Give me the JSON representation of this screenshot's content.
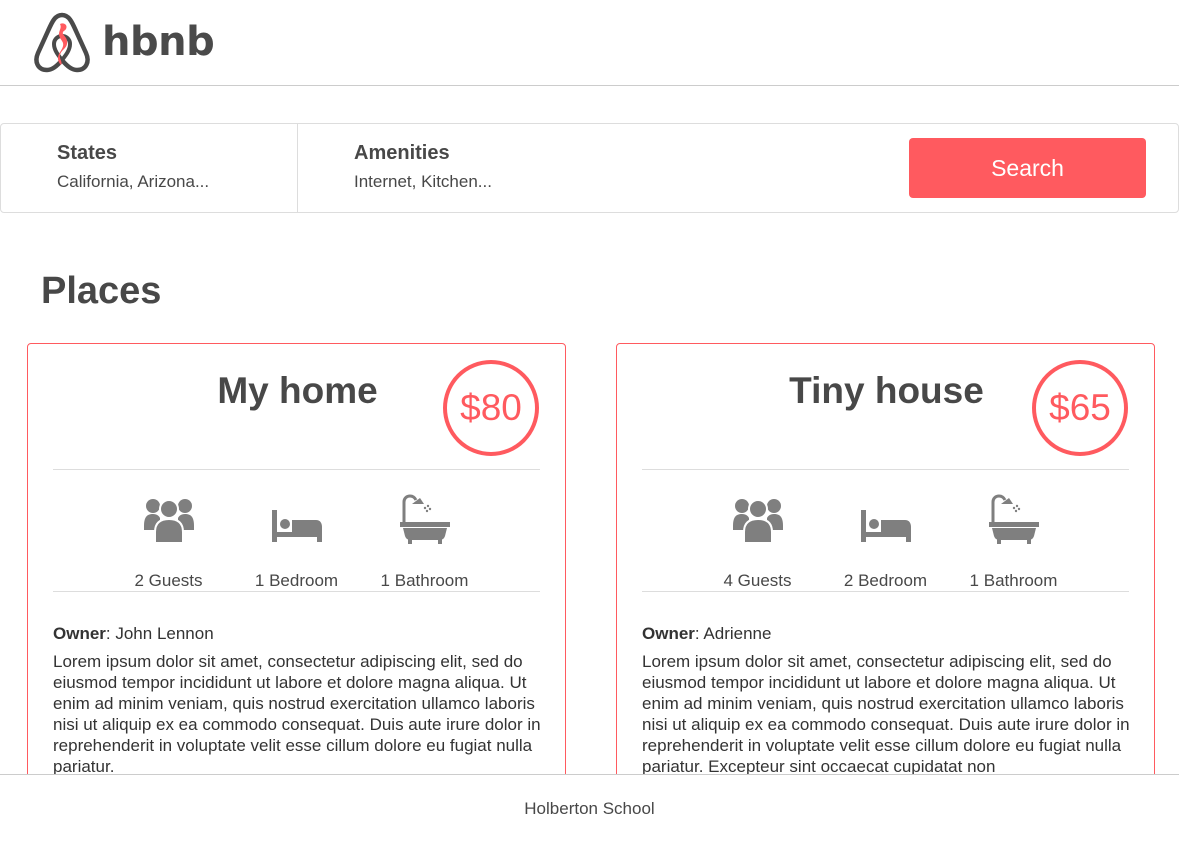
{
  "header": {
    "brand": "hbnb",
    "logo_icon": "seahorse-logo-icon"
  },
  "filters": {
    "states": {
      "title": "States",
      "value": "California, Arizona..."
    },
    "amenities": {
      "title": "Amenities",
      "value": "Internet, Kitchen..."
    },
    "search_label": "Search"
  },
  "places": {
    "title": "Places",
    "items": [
      {
        "name": "My home",
        "price": "$80",
        "guests": "2 Guests",
        "rooms": "1 Bedroom",
        "baths": "1 Bathroom",
        "owner_label": "Owner",
        "owner": ": John Lennon",
        "description": "Lorem ipsum dolor sit amet, consectetur adipiscing elit, sed do eiusmod tempor incididunt ut labore et dolore magna aliqua. Ut enim ad minim veniam, quis nostrud exercitation ullamco laboris nisi ut aliquip ex ea commodo consequat. Duis aute irure dolor in reprehenderit in voluptate velit esse cillum dolore eu fugiat nulla pariatur."
      },
      {
        "name": "Tiny house",
        "price": "$65",
        "guests": "4 Guests",
        "rooms": "2 Bedroom",
        "baths": "1 Bathroom",
        "owner_label": "Owner",
        "owner": ": Adrienne",
        "description": "Lorem ipsum dolor sit amet, consectetur adipiscing elit, sed do eiusmod tempor incididunt ut labore et dolore magna aliqua. Ut enim ad minim veniam, quis nostrud exercitation ullamco laboris nisi ut aliquip ex ea commodo consequat. Duis aute irure dolor in reprehenderit in voluptate velit esse cillum dolore eu fugiat nulla pariatur. Excepteur sint occaecat cupidatat non"
      }
    ]
  },
  "footer": {
    "text": "Holberton School"
  },
  "colors": {
    "accent": "#ff5a5f",
    "text": "#484848",
    "icon": "#7f7f7f",
    "border": "#dddddd"
  }
}
